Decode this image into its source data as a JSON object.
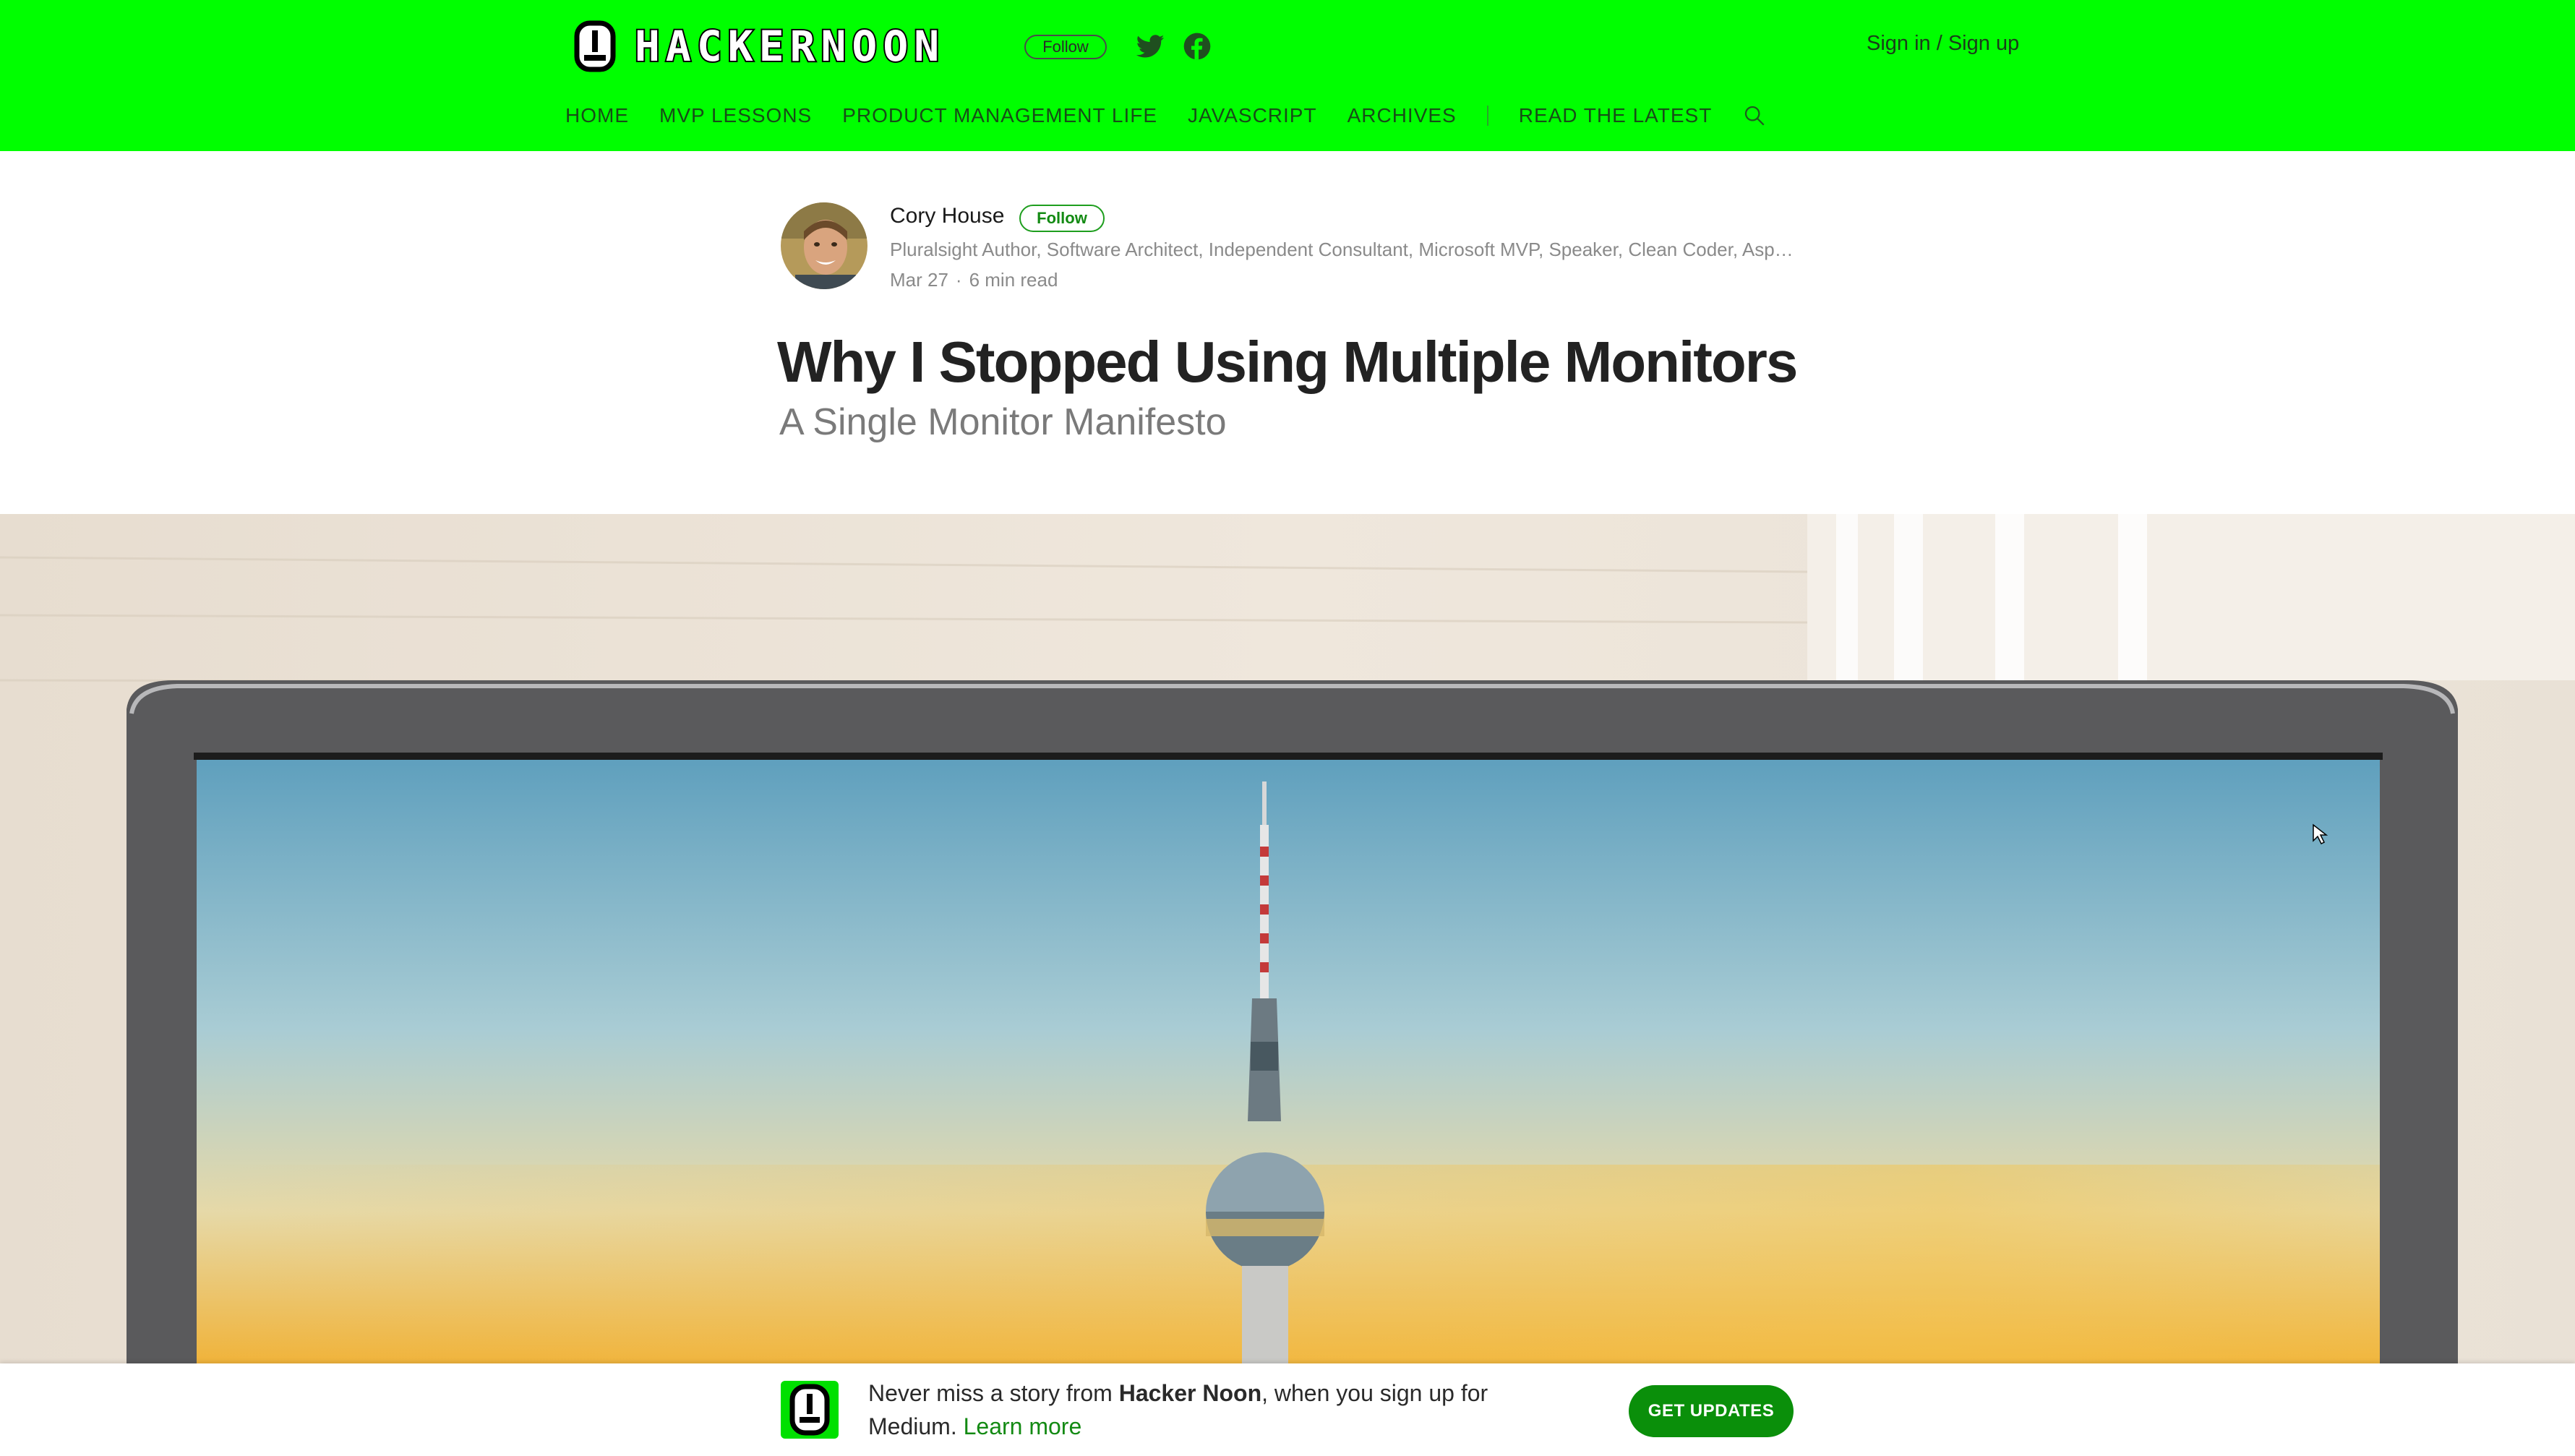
{
  "header": {
    "logo_text": "HACKERNOON",
    "follow_label": "Follow",
    "auth_label": "Sign in / Sign up",
    "nav": [
      "HOME",
      "MVP LESSONS",
      "PRODUCT MANAGEMENT LIFE",
      "JAVASCRIPT",
      "ARCHIVES"
    ],
    "read_latest": "READ THE LATEST",
    "icons": [
      "twitter-icon",
      "facebook-icon",
      "search-icon"
    ]
  },
  "author": {
    "name": "Cory House",
    "follow_label": "Follow",
    "bio": "Pluralsight Author, Software Architect, Independent Consultant, Microsoft MVP, Speaker, Clean Coder, Aspiring Outlier.",
    "date": "Mar 27",
    "read_time": "6 min read"
  },
  "article": {
    "title": "Why I Stopped Using Multiple Monitors",
    "subtitle": "A Single Monitor Manifesto"
  },
  "banner": {
    "text_prefix": "Never miss a story from ",
    "publication": "Hacker Noon",
    "text_suffix": ", when you sign up for Medium. ",
    "learn_more": "Learn more",
    "button_label": "GET UPDATES"
  },
  "colors": {
    "brand_green": "#00ff00",
    "accent_green": "#0a8f0a",
    "title_text": "#222222",
    "muted_text": "#8a8a8a"
  }
}
